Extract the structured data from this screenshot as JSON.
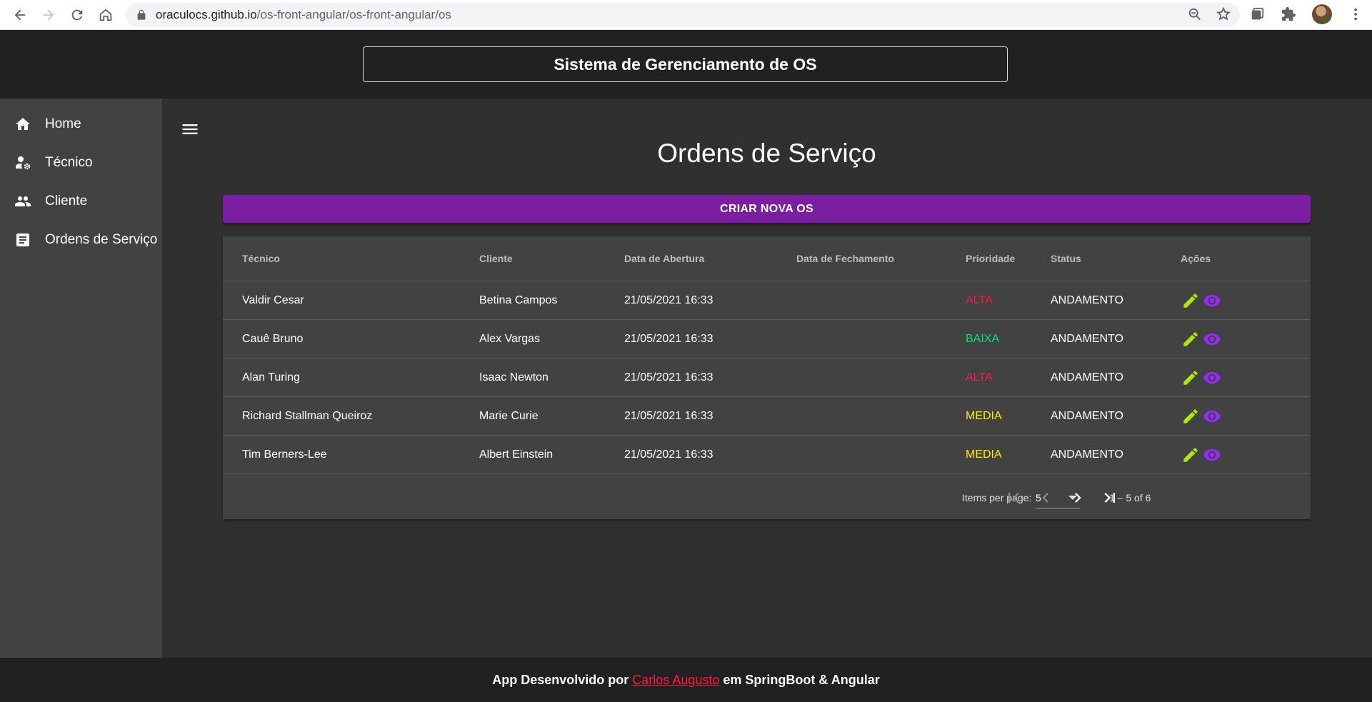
{
  "browser": {
    "url_host": "oraculocs.github.io",
    "url_path": "/os-front-angular/os-front-angular/os"
  },
  "header": {
    "title": "Sistema de Gerenciamento de OS"
  },
  "sidebar": {
    "items": [
      {
        "label": "Home",
        "icon": "home-icon"
      },
      {
        "label": "Técnico",
        "icon": "person-gear-icon"
      },
      {
        "label": "Cliente",
        "icon": "people-icon"
      },
      {
        "label": "Ordens de Serviço",
        "icon": "document-icon"
      }
    ]
  },
  "main": {
    "title": "Ordens de Serviço",
    "create_button": "CRIAR NOVA OS",
    "columns": [
      "Técnico",
      "Cliente",
      "Data de Abertura",
      "Data de Fechamento",
      "Prioridade",
      "Status",
      "Ações"
    ],
    "rows": [
      {
        "tecnico": "Valdir Cesar",
        "cliente": "Betina Campos",
        "abertura": "21/05/2021 16:33",
        "fechamento": "",
        "prioridade": "ALTA",
        "status": "ANDAMENTO"
      },
      {
        "tecnico": "Cauê Bruno",
        "cliente": "Alex Vargas",
        "abertura": "21/05/2021 16:33",
        "fechamento": "",
        "prioridade": "BAIXA",
        "status": "ANDAMENTO"
      },
      {
        "tecnico": "Alan Turing",
        "cliente": "Isaac Newton",
        "abertura": "21/05/2021 16:33",
        "fechamento": "",
        "prioridade": "ALTA",
        "status": "ANDAMENTO"
      },
      {
        "tecnico": "Richard Stallman Queiroz",
        "cliente": "Marie Curie",
        "abertura": "21/05/2021 16:33",
        "fechamento": "",
        "prioridade": "MEDIA",
        "status": "ANDAMENTO"
      },
      {
        "tecnico": "Tim Berners-Lee",
        "cliente": "Albert Einstein",
        "abertura": "21/05/2021 16:33",
        "fechamento": "",
        "prioridade": "MEDIA",
        "status": "ANDAMENTO"
      }
    ],
    "paginator": {
      "label": "Items per page:",
      "page_size": "5",
      "range": "1 – 5 of 6"
    }
  },
  "colors": {
    "accent": "#7b1fa2",
    "prio_alta": "#ff1744",
    "prio_baixa": "#00e676",
    "prio_media": "#ffea00",
    "edit_icon": "#aeea00",
    "view_icon": "#9c27ff"
  },
  "footer": {
    "prefix": "App Desenvolvido por",
    "author": "Carlos Augusto",
    "suffix": "em SpringBoot & Angular"
  }
}
